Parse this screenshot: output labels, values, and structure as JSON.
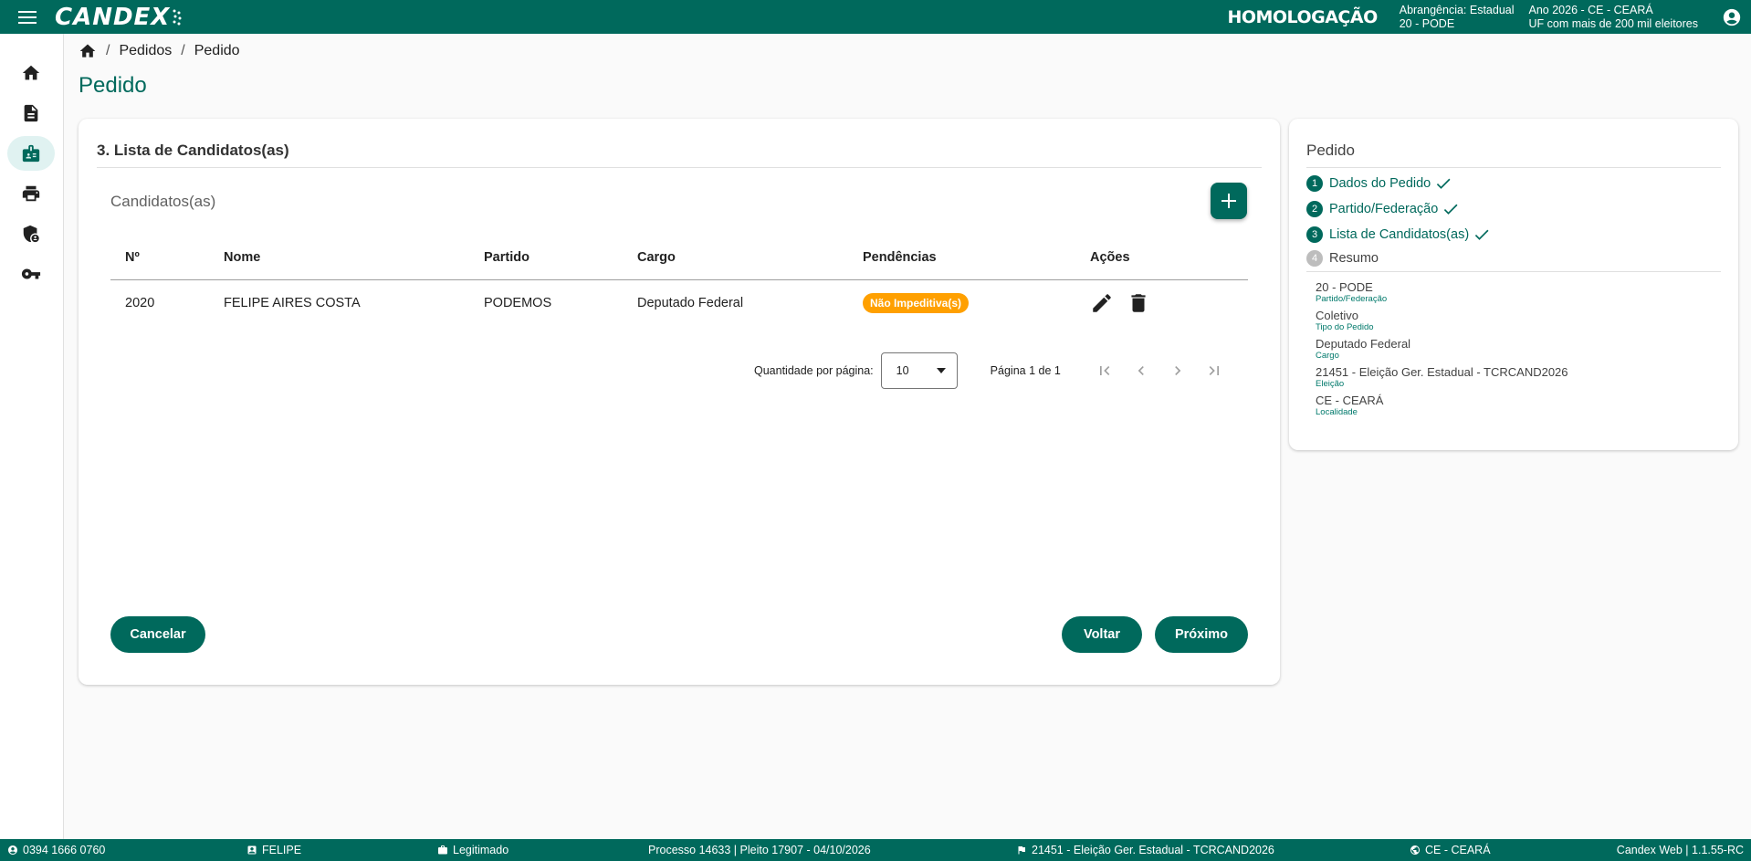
{
  "app": {
    "logo": "CANDEX",
    "environment": "HOMOLOGAÇÃO",
    "scope_line1": "Abrangência: Estadual",
    "scope_line2": "20 - PODE",
    "year_line1": "Ano 2026 - CE - CEARÁ",
    "year_line2": "UF com mais de 200 mil eleitores"
  },
  "sidenav": {
    "items": [
      {
        "icon": "home-icon"
      },
      {
        "icon": "document-icon"
      },
      {
        "icon": "candidate-badge-icon",
        "active": true
      },
      {
        "icon": "print-icon"
      },
      {
        "icon": "security-user-icon"
      },
      {
        "icon": "key-icon"
      }
    ]
  },
  "breadcrumb": {
    "items": [
      "Pedidos",
      "Pedido"
    ],
    "separator": "/"
  },
  "page": {
    "title": "Pedido"
  },
  "main": {
    "section_title": "3. Lista de Candidatos(as)",
    "list_title": "Candidatos(as)",
    "table": {
      "headers": [
        "Nº",
        "Nome",
        "Partido",
        "Cargo",
        "Pendências",
        "Ações"
      ],
      "rows": [
        {
          "numero": "2020",
          "nome": "FELIPE AIRES COSTA",
          "partido": "PODEMOS",
          "cargo": "Deputado Federal",
          "pendencia": "Não Impeditiva(s)"
        }
      ]
    },
    "paginator": {
      "label": "Quantidade por página:",
      "page_size": "10",
      "range": "Página 1 de 1"
    },
    "buttons": {
      "cancel": "Cancelar",
      "back": "Voltar",
      "next": "Próximo"
    }
  },
  "side": {
    "title": "Pedido",
    "steps": [
      {
        "num": "1",
        "label": "Dados do Pedido",
        "done": true
      },
      {
        "num": "2",
        "label": "Partido/Federação",
        "done": true
      },
      {
        "num": "3",
        "label": "Lista de Candidatos(as)",
        "done": true
      },
      {
        "num": "4",
        "label": "Resumo",
        "done": false
      }
    ],
    "summary": [
      {
        "value": "20 - PODE",
        "label": "Partido/Federação"
      },
      {
        "value": "Coletivo",
        "label": "Tipo do Pedido"
      },
      {
        "value": "Deputado Federal",
        "label": "Cargo"
      },
      {
        "value": "21451 - Eleição Ger. Estadual - TCRCAND2026",
        "label": "Eleição"
      },
      {
        "value": "CE - CEARÁ",
        "label": "Localidade"
      }
    ]
  },
  "footer": {
    "cpf": "0394 1666 0760",
    "user": "FELIPE",
    "status": "Legitimado",
    "process": "Processo 14633 | Pleito 17907 - 04/10/2026",
    "election": "21451 - Eleição Ger. Estadual - TCRCAND2026",
    "location": "CE - CEARÁ",
    "version": "Candex Web | 1.1.55-RC"
  },
  "colors": {
    "primary": "#00695c",
    "badge": "#ffa000",
    "background": "#fafafa"
  }
}
